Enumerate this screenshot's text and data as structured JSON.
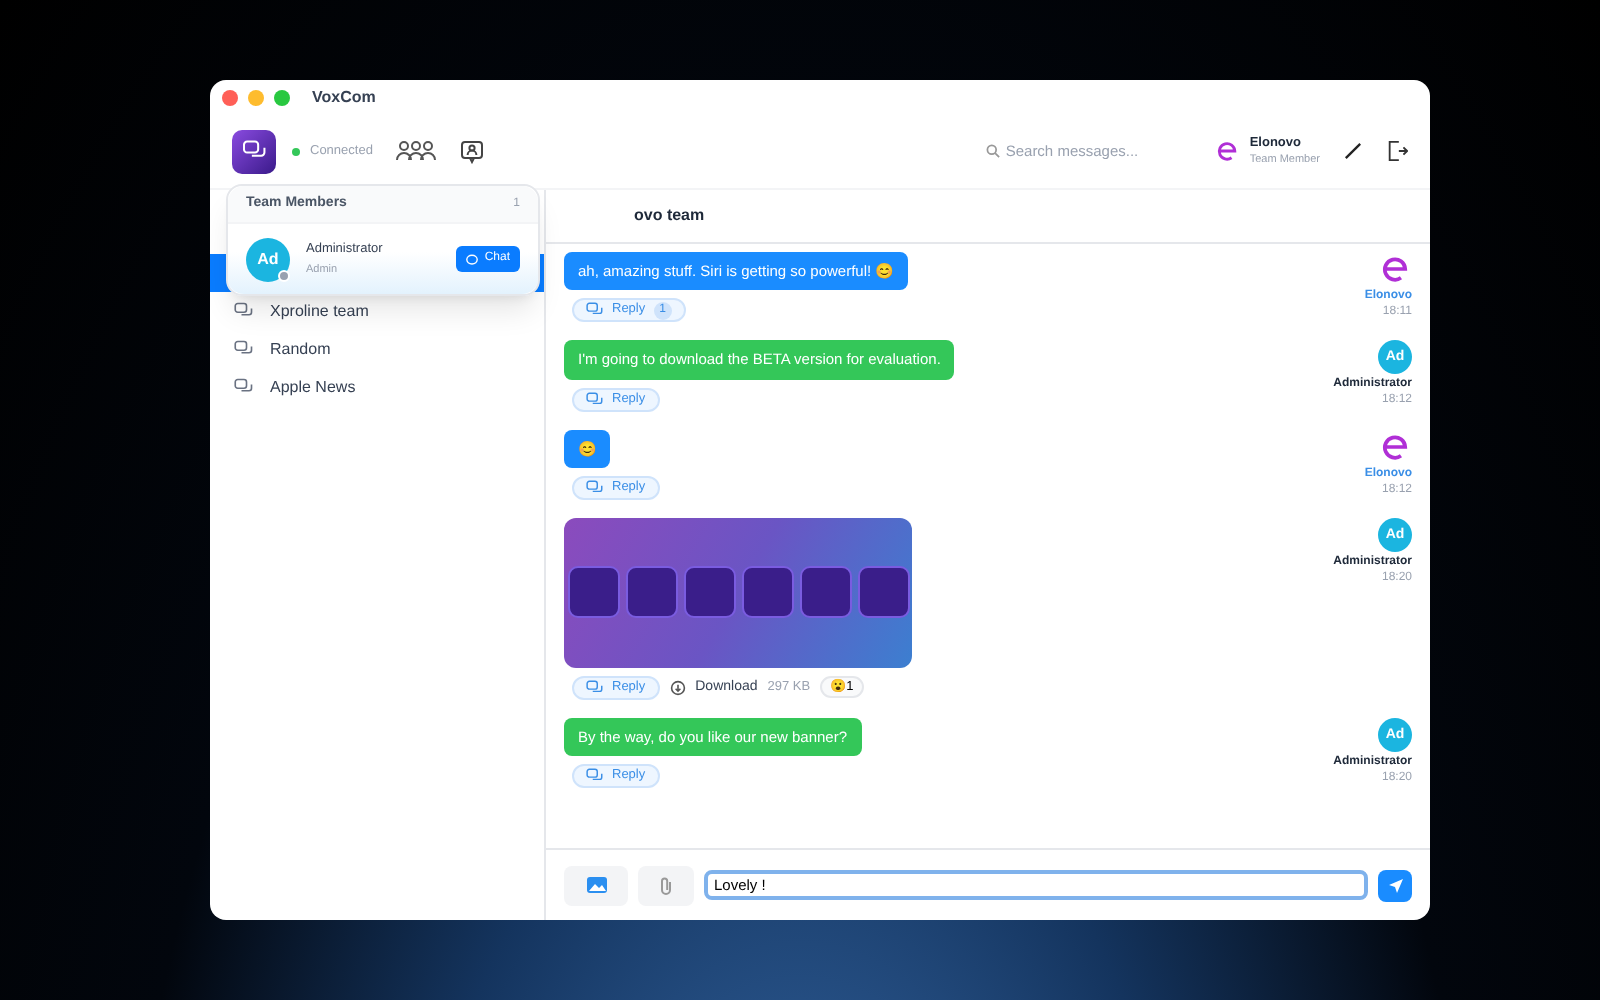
{
  "window": {
    "title": "VoxCom"
  },
  "toolbar": {
    "status": "Connected",
    "search": {
      "placeholder": "Search messages..."
    },
    "user": {
      "name": "Elonovo",
      "role": "Team Member"
    }
  },
  "popover": {
    "title": "Team Members",
    "count": "1",
    "member": {
      "initials": "Ad",
      "name": "Administrator",
      "role": "Admin",
      "online": false,
      "action": "Chat"
    }
  },
  "sidebar": {
    "items": [
      {
        "selected": true
      },
      {
        "label": "Xproline team",
        "selected": false
      },
      {
        "label": "Random",
        "selected": false
      },
      {
        "label": "Apple News",
        "selected": false
      }
    ]
  },
  "channel": {
    "title": "ovo team"
  },
  "messages": [
    {
      "kind": "text",
      "text": "ah, amazing stuff. Siri is getting so powerful! 😊",
      "color": "#1a8cff",
      "sender": "Elonovo",
      "avatar": {
        "kind": "logo"
      },
      "time": "18:11",
      "reply": "Reply",
      "reply_count": "1"
    },
    {
      "kind": "text",
      "text": "I'm going to download the BETA version for evaluation.",
      "color": "#34c759",
      "sender": "Administrator",
      "avatar": {
        "kind": "initials",
        "text": "Ad"
      },
      "time": "18:12",
      "reply": "Reply"
    },
    {
      "kind": "text",
      "text": "😊",
      "color": "#1a8cff",
      "sender": "Elonovo",
      "avatar": {
        "kind": "logo"
      },
      "time": "18:12",
      "reply": "Reply"
    },
    {
      "kind": "image",
      "sender": "Administrator",
      "avatar": {
        "kind": "initials",
        "text": "Ad"
      },
      "time": "18:20",
      "reply": "Reply",
      "download": "Download",
      "size": "297 KB",
      "reaction": "😮",
      "reaction_count": "1"
    },
    {
      "kind": "text",
      "text": "By the way, do you like our new banner?",
      "color": "#34c759",
      "sender": "Administrator",
      "avatar": {
        "kind": "initials",
        "text": "Ad"
      },
      "time": "18:20",
      "reply": "Reply"
    }
  ],
  "composer": {
    "value": "Lovely !"
  }
}
